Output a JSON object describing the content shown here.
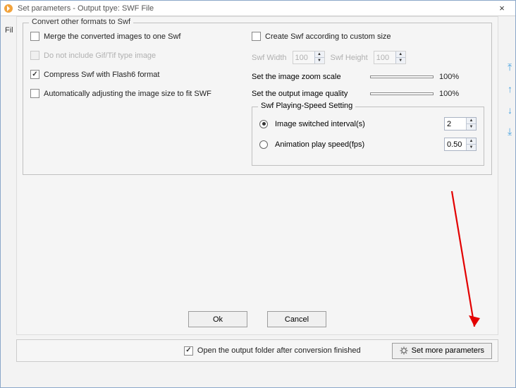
{
  "window": {
    "title": "Set parameters - Output tpye: SWF File",
    "close": "×",
    "menu_stub": "Fil"
  },
  "group": {
    "legend": "Convert other formats to Swf",
    "left": {
      "merge": "Merge the converted images to one Swf",
      "exclude": "Do not include Gif/Tif type image",
      "compress": "Compress Swf with Flash6 format",
      "autosize": "Automatically adjusting the image size to fit SWF"
    },
    "right": {
      "custom": "Create Swf according to custom size",
      "swf_width_lbl": "Swf Width",
      "swf_width_val": "100",
      "swf_height_lbl": "Swf Height",
      "swf_height_val": "100",
      "zoom_lbl": "Set the image zoom scale",
      "zoom_pct": "100%",
      "quality_lbl": "Set the output image quality",
      "quality_pct": "100%",
      "speed_legend": "Swf Playing-Speed Setting",
      "radio_interval": "Image switched interval(s)",
      "interval_val": "2",
      "radio_fps": "Animation play speed(fps)",
      "fps_val": "0.50"
    }
  },
  "buttons": {
    "ok": "Ok",
    "cancel": "Cancel"
  },
  "footer": {
    "open_after": "Open the output folder after conversion finished",
    "more": "Set more parameters"
  }
}
